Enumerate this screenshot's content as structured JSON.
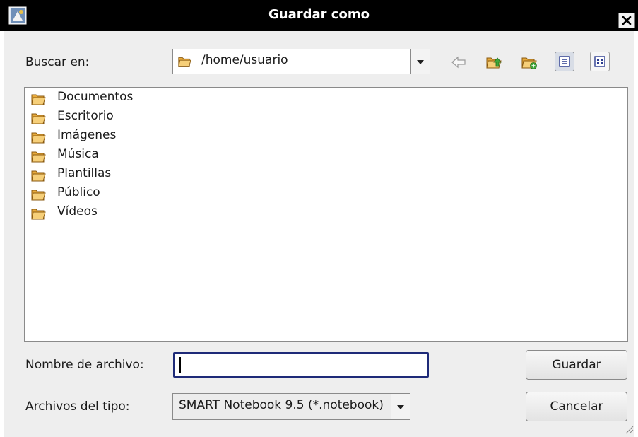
{
  "window": {
    "title": "Guardar como",
    "app_icon": "dialog-app-icon",
    "close_icon": "close-icon"
  },
  "location": {
    "label": "Buscar en:",
    "value": "/home/usuario",
    "folder_icon": "folder-icon",
    "dropdown_icon": "chevron-down-icon"
  },
  "toolbar": {
    "icons": [
      "back-arrow-icon",
      "folder-up-icon",
      "new-folder-icon",
      "list-view-icon",
      "icon-view-icon"
    ],
    "active_view": "list"
  },
  "files": [
    {
      "name": "Documentos",
      "icon": "folder-icon"
    },
    {
      "name": "Escritorio",
      "icon": "folder-icon"
    },
    {
      "name": "Imágenes",
      "icon": "folder-icon"
    },
    {
      "name": "Música",
      "icon": "folder-icon"
    },
    {
      "name": "Plantillas",
      "icon": "folder-icon"
    },
    {
      "name": "Público",
      "icon": "folder-icon"
    },
    {
      "name": "Vídeos",
      "icon": "folder-icon"
    }
  ],
  "filename": {
    "label": "Nombre de archivo:",
    "value": ""
  },
  "filetype": {
    "label": "Archivos del tipo:",
    "value": "SMART Notebook 9.5 (*.notebook)",
    "dropdown_icon": "chevron-down-icon"
  },
  "buttons": {
    "save": "Guardar",
    "cancel": "Cancelar"
  },
  "colors": {
    "titlebar": "#000000",
    "dialog_bg": "#eeeeee",
    "input_focus": "#1e2a78",
    "folder": "#f2c265"
  }
}
